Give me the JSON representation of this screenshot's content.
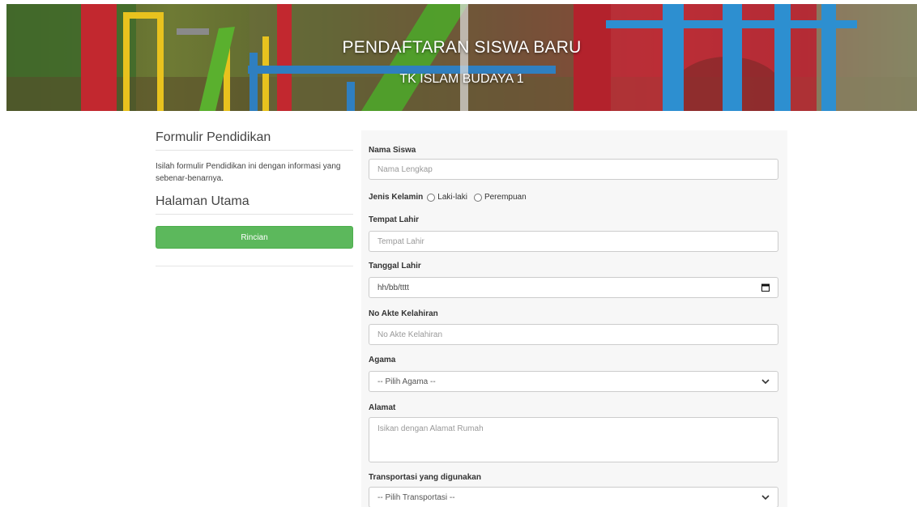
{
  "banner": {
    "title": "PENDAFTARAN SISWA BARU",
    "subtitle": "TK ISLAM BUDAYA 1"
  },
  "sidebar": {
    "heading": "Formulir Pendidikan",
    "description": "Isilah formulir Pendidikan ini dengan informasi yang sebenar-benarnya.",
    "home_heading": "Halaman Utama",
    "rincian_button": "Rincian"
  },
  "form": {
    "nama_siswa": {
      "label": "Nama Siswa",
      "placeholder": "Nama Lengkap"
    },
    "jenis_kelamin": {
      "label": "Jenis Kelamin",
      "options": [
        "Laki-laki",
        "Perempuan"
      ]
    },
    "tempat_lahir": {
      "label": "Tempat Lahir",
      "placeholder": "Tempat Lahir"
    },
    "tanggal_lahir": {
      "label": "Tanggal Lahir",
      "value": "hh/bb/tttt"
    },
    "no_akte": {
      "label": "No Akte Kelahiran",
      "placeholder": "No Akte Kelahiran"
    },
    "agama": {
      "label": "Agama",
      "selected": "-- Pilih Agama --"
    },
    "alamat": {
      "label": "Alamat",
      "placeholder": "Isikan dengan Alamat Rumah"
    },
    "transportasi": {
      "label": "Transportasi yang digunakan",
      "selected": "-- Pilih Transportasi --"
    }
  },
  "colors": {
    "button_green": "#5cb85c",
    "panel_bg": "#f7f7f7",
    "input_border": "#cccccc"
  },
  "icons": {
    "date_picker": "calendar-icon",
    "select_arrow": "chevron-down-icon"
  }
}
